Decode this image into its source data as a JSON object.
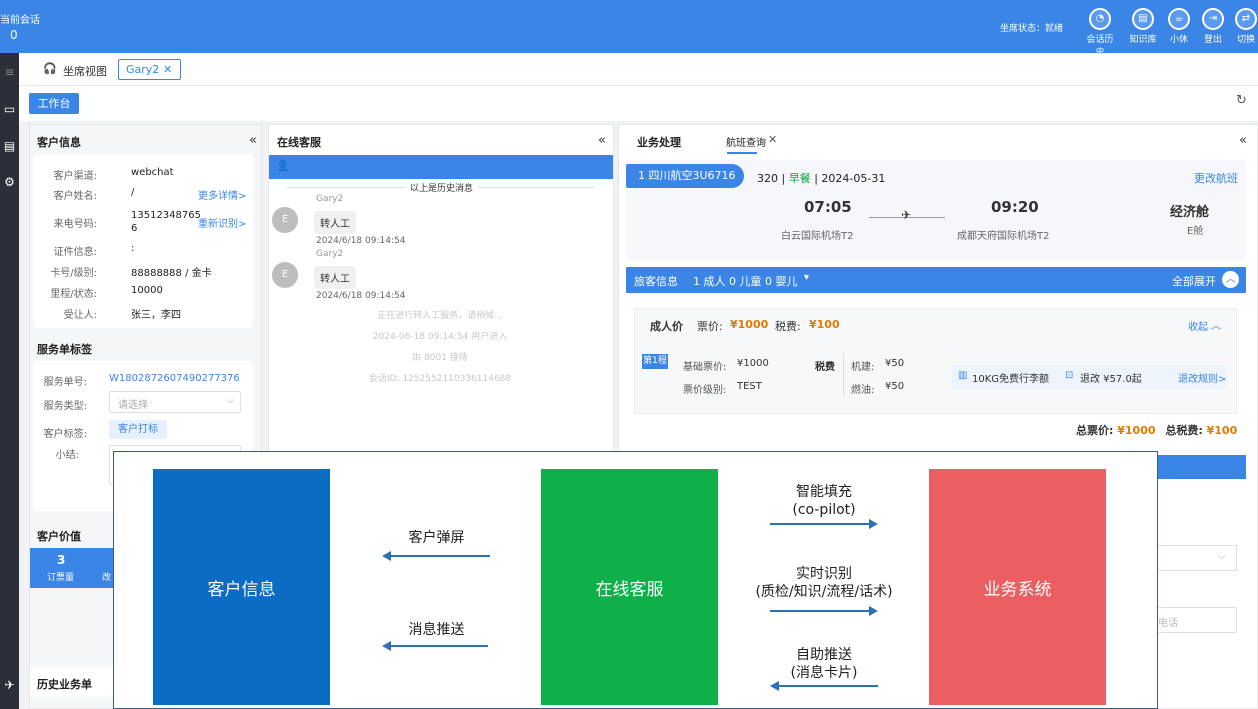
{
  "topbar": {
    "session_label": "当前会话",
    "session_count": "0",
    "agent_status": "坐席状态：就绪",
    "icons": [
      {
        "icon": "chat-history-icon",
        "label": "会话历史"
      },
      {
        "icon": "knowledge-icon",
        "label": "知识库"
      },
      {
        "icon": "coffee-icon",
        "label": "小休"
      },
      {
        "icon": "logout-icon",
        "label": "登出"
      },
      {
        "icon": "switch-icon",
        "label": "切换"
      }
    ]
  },
  "tabs": {
    "view_label": "坐席视图",
    "user_tab": "Gary2",
    "close": "✕"
  },
  "workspace": {
    "label": "工作台"
  },
  "customer": {
    "title": "客户信息",
    "fields": [
      {
        "label": "客户渠道:",
        "value": "webchat",
        "link": ""
      },
      {
        "label": "客户姓名:",
        "value": "/",
        "link": "更多详情>"
      },
      {
        "label": "来电号码:",
        "value": "13512348765 6",
        "link": "重新识别>"
      },
      {
        "label": "证件信息:",
        "value": ":",
        "link": ""
      },
      {
        "label": "卡号/级别:",
        "value": "88888888 / 金卡",
        "link": ""
      },
      {
        "label": "里程/状态:",
        "value": "10000",
        "link": ""
      },
      {
        "label": "受让人:",
        "value": "张三，李四",
        "link": ""
      }
    ]
  },
  "service_tag": {
    "title": "服务单标签",
    "order_no_label": "服务单号:",
    "order_no": "W1802872607490277376",
    "type_label": "服务类型:",
    "type_placeholder": "请选择",
    "tag_label": "客户标签:",
    "tag_button": "客户打标",
    "summary_label": "小结:"
  },
  "customer_value": {
    "title": "客户价值",
    "count": "3",
    "count_label": "订票量",
    "count2_label": "改"
  },
  "history": {
    "title": "历史业务单"
  },
  "online": {
    "title": "在线客服",
    "history_note": "以上是历史消息",
    "messages": [
      {
        "sender": "Gary2",
        "avatar": "E",
        "text": "转人工",
        "time": "2024/6/18 09:14:54"
      },
      {
        "sender": "Gary2",
        "avatar": "E",
        "text": "转人工",
        "time": "2024/6/18 09:14:54"
      }
    ],
    "system": [
      "正在进行转人工服务，请稍候...",
      "2024-06-18 09:14:54 用户进入",
      "由 8001 接待",
      "会话ID: 1252552110336114688"
    ]
  },
  "business": {
    "tab1": "业务处理",
    "tab2": "航班查询",
    "flight": {
      "index_airline": "1  四川航空3U6716",
      "model": "320",
      "meal": "早餐",
      "date": "2024-05-31",
      "change": "更改航班",
      "dep_time": "07:05",
      "dep_airport": "白云国际机场T2",
      "arr_time": "09:20",
      "arr_airport": "成都天府国际机场T2",
      "cabin": "经济舱",
      "cabin_code": "E舱"
    },
    "pax_bar": {
      "label": "旅客信息",
      "summary": "1 成人 0 儿童 0 婴儿",
      "expand": "全部展开"
    },
    "adult": {
      "label": "成人价",
      "fare_label": "票价:",
      "fare": "¥1000",
      "tax_label": "税费:",
      "tax": "¥100",
      "collapse": "收起",
      "leg": "第1程",
      "base_label": "基础票价:",
      "base": "¥1000",
      "level_label": "票价级别:",
      "level": "TEST",
      "tax_title": "税费",
      "airport_tax_label": "机建:",
      "airport_tax": "¥50",
      "fuel_label": "燃油:",
      "fuel": "¥50",
      "baggage": "10KG免费行李额",
      "refund": "退改 ¥57.0起",
      "rule": "退改规则>"
    },
    "total": {
      "fare_label": "总票价:",
      "fare": "¥1000",
      "tax_label": "总税费:",
      "tax": "¥100"
    },
    "phone_placeholder": "电话"
  },
  "diagram": {
    "box1": "客户信息",
    "box2": "在线客服",
    "box3": "业务系统",
    "a1": "客户弹屏",
    "a2": "消息推送",
    "a3a": "智能填充",
    "a3b": "(co-pilot)",
    "a4a": "实时识别",
    "a4b": "(质检/知识/流程/话术)",
    "a5a": "自助推送",
    "a5b": "(消息卡片)",
    "colors": {
      "box1": "#0b6cc4",
      "box2": "#0fb04a",
      "box3": "#eb5f63"
    }
  }
}
